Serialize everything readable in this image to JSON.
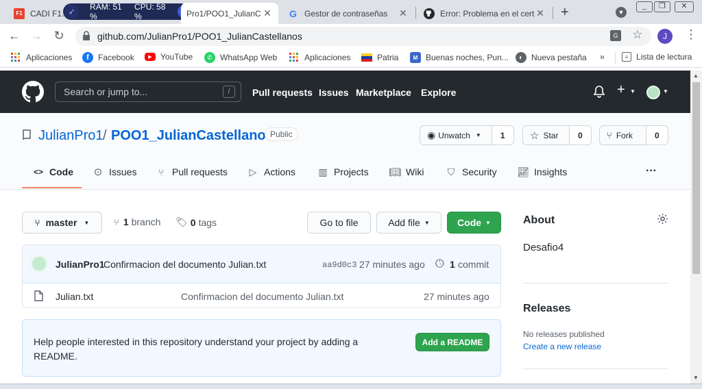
{
  "browser": {
    "tabs": [
      {
        "title": "CADI F1."
      },
      {
        "title": "Pro1/POO1_JulianC"
      },
      {
        "title": "Gestor de contraseñas"
      },
      {
        "title": "Error: Problema en el cert"
      }
    ],
    "sysmon": {
      "ram": "RAM: 51 %",
      "cpu": "CPU: 58 %"
    },
    "url": "github.com/JulianPro1/POO1_JulianCastellanos",
    "profile_initial": "J",
    "bookmarks": [
      {
        "label": "Aplicaciones"
      },
      {
        "label": "Facebook"
      },
      {
        "label": "YouTube"
      },
      {
        "label": "WhatsApp Web"
      },
      {
        "label": "Aplicaciones"
      },
      {
        "label": "Patria"
      },
      {
        "label": "Buenas noches, Pun..."
      },
      {
        "label": "Nueva pestaña"
      },
      {
        "label": "Lista de lectura"
      }
    ],
    "more_bookmarks": "»"
  },
  "github": {
    "search_placeholder": "Search or jump to...",
    "search_key": "/",
    "nav": [
      "Pull requests",
      "Issues",
      "Marketplace",
      "Explore"
    ],
    "owner": "JulianPro1",
    "separator": "/",
    "repo": "POO1_JulianCastellanos",
    "visibility": "Public",
    "unwatch_label": "Unwatch",
    "watch_count": "1",
    "star_label": "Star",
    "star_count": "0",
    "fork_label": "Fork",
    "fork_count": "0",
    "repo_tabs": [
      "Code",
      "Issues",
      "Pull requests",
      "Actions",
      "Projects",
      "Wiki",
      "Security",
      "Insights"
    ],
    "more": "···",
    "branch": "master",
    "branch_count": "1",
    "branch_label": "branch",
    "tag_count": "0",
    "tag_label": "tags",
    "goto_file": "Go to file",
    "add_file": "Add file",
    "code_btn": "Code",
    "commit": {
      "author": "JulianPro1",
      "message": "Confirmacion del documento Julian.txt",
      "sha": "aa9d0c3",
      "time": "27 minutes ago",
      "count": "1",
      "count_label": "commit"
    },
    "files": [
      {
        "name": "Julian.txt",
        "message": "Confirmacion del documento Julian.txt",
        "time": "27 minutes ago"
      }
    ],
    "readme_prompt": "Help people interested in this repository understand your project by adding a README.",
    "readme_button": "Add a README",
    "about": {
      "title": "About",
      "description": "Desafio4"
    },
    "releases": {
      "title": "Releases",
      "none": "No releases published",
      "create": "Create a new release"
    }
  }
}
